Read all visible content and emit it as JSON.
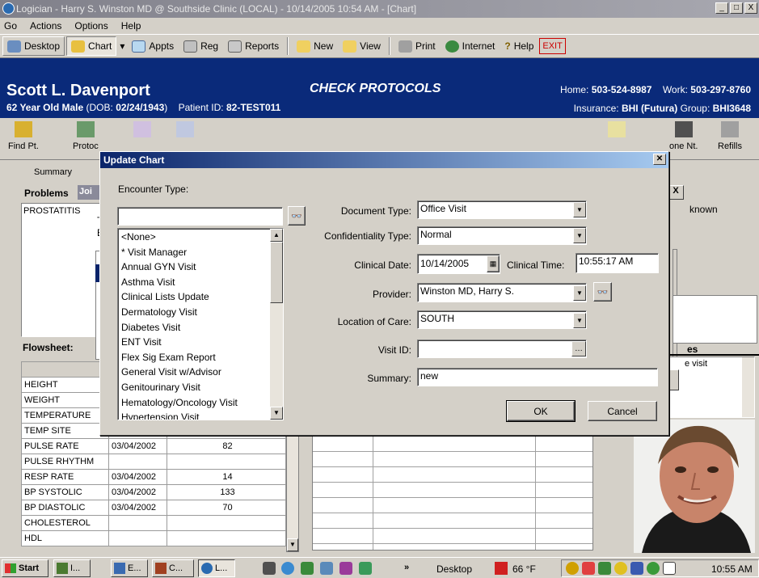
{
  "window": {
    "title": "Logician - Harry S. Winston MD @ Southside Clinic (LOCAL) - 10/14/2005 10:54 AM - [Chart]",
    "buttons": [
      "_",
      "□",
      "X"
    ]
  },
  "menu": [
    "Go",
    "Actions",
    "Options",
    "Help"
  ],
  "toolbar": {
    "desktop": "Desktop",
    "chart": "Chart",
    "appts": "Appts",
    "reg": "Reg",
    "reports": "Reports",
    "new": "New",
    "view": "View",
    "print": "Print",
    "internet": "Internet",
    "help": "Help",
    "exit": "EXIT"
  },
  "patient": {
    "name": "Scott L. Davenport",
    "summary": "62 Year Old Male",
    "dob_label": " (DOB: ",
    "dob": "02/24/1943",
    "dob_close": ")",
    "id_label": "Patient ID: ",
    "id": "82-TEST011",
    "home_label": "Home: ",
    "home": "503-524-8987",
    "work_label": "Work: ",
    "work": "503-297-8760",
    "ins_label": "Insurance: ",
    "ins": "BHI (Futura)",
    "group_label": " Group: ",
    "group": "BHI3648",
    "mode": "CHECK PROTOCOLS"
  },
  "toolbar2": {
    "find": "Find Pt.",
    "protocols": "Protoc",
    "phone": "one Nt.",
    "refills": "Refills"
  },
  "left_panel": {
    "tab": "Summary",
    "problems": "Problems",
    "problems_tab": "Joi",
    "problem_item": "PROSTATITIS",
    "flowsheet": "Flowsheet:",
    "partial_t": "T",
    "partial_e": "E",
    "partial_star": "*"
  },
  "right_panel": {
    "known": "known",
    "es": "es",
    "visit": "e visit"
  },
  "flowsheet": [
    {
      "name": "HEIGHT",
      "date": "",
      "val": ""
    },
    {
      "name": "WEIGHT",
      "date": "",
      "val": ""
    },
    {
      "name": "TEMPERATURE",
      "date": "",
      "val": ""
    },
    {
      "name": "TEMP SITE",
      "date": "",
      "val": ""
    },
    {
      "name": "PULSE RATE",
      "date": "03/04/2002",
      "val": "82"
    },
    {
      "name": "PULSE RHYTHM",
      "date": "",
      "val": ""
    },
    {
      "name": "RESP RATE",
      "date": "03/04/2002",
      "val": "14"
    },
    {
      "name": "BP SYSTOLIC",
      "date": "03/04/2002",
      "val": "133"
    },
    {
      "name": "BP DIASTOLIC",
      "date": "03/04/2002",
      "val": "70"
    },
    {
      "name": "CHOLESTEROL",
      "date": "",
      "val": ""
    },
    {
      "name": "HDL",
      "date": "",
      "val": ""
    }
  ],
  "dialog": {
    "title": "Update Chart",
    "encounter_label": "Encounter Type:",
    "encounter_search": "",
    "encounter_list": [
      "<None>",
      "* Visit Manager",
      "Annual GYN Visit",
      "Asthma Visit",
      "Clinical Lists Update",
      "Dermatology Visit",
      "Diabetes Visit",
      "ENT Visit",
      "Flex Sig Exam Report",
      "General Visit w/Advisor",
      "Genitourinary Visit",
      "Hematology/Oncology Visit",
      "Hypertension Visit"
    ],
    "doc_type_label": "Document Type:",
    "doc_type": "Office Visit",
    "conf_label": "Confidentiality Type:",
    "conf": "Normal",
    "date_label": "Clinical Date:",
    "date": "10/14/2005",
    "time_label": "Clinical Time:",
    "time": "10:55:17 AM",
    "provider_label": "Provider:",
    "provider": "Winston MD, Harry S.",
    "loc_label": "Location of Care:",
    "loc": "SOUTH",
    "visit_label": "Visit ID:",
    "visit": "",
    "summary_label": "Summary:",
    "summary": "new",
    "ok": "OK",
    "cancel": "Cancel"
  },
  "taskbar": {
    "start": "Start",
    "tasks": [
      "I...",
      "E...",
      "C...",
      "L..."
    ],
    "desktop": "Desktop",
    "temp": "66 °F",
    "time": "10:55 AM"
  },
  "colors": {
    "header": "#0a2a7a",
    "dialog_title": "#0a246a"
  }
}
